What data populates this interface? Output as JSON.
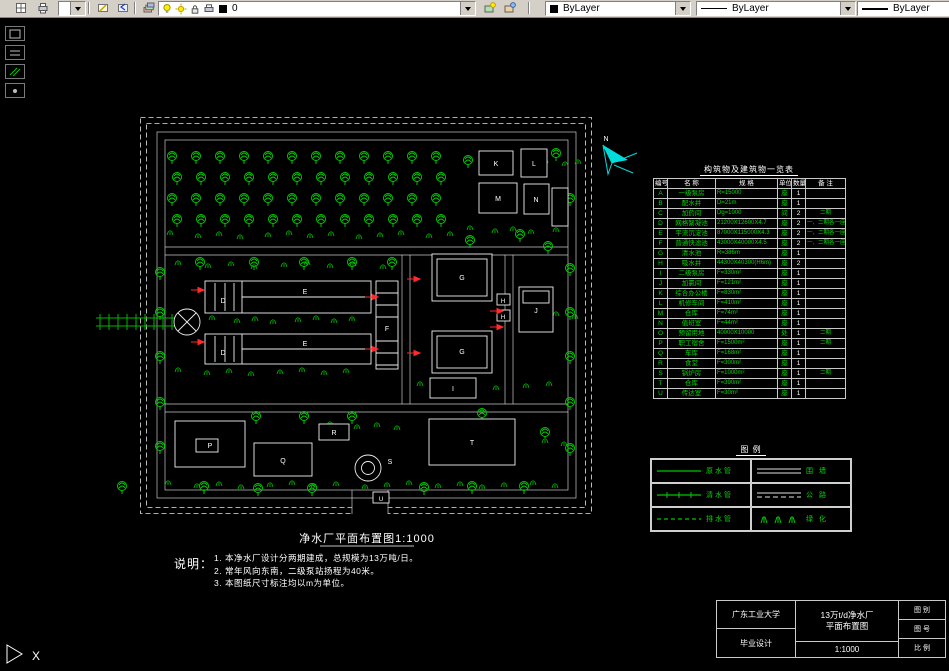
{
  "toolbar": {
    "layer_name": "0",
    "color_value": "ByLayer",
    "linetype_value": "ByLayer",
    "lineweight_value": "ByLayer"
  },
  "plan": {
    "title": "净水厂平面布置图1:1000",
    "north": "N",
    "letters": {
      "D": "D",
      "E": "E",
      "F": "F",
      "G": "G",
      "H": "H",
      "I": "I",
      "J": "J",
      "K": "K",
      "L": "L",
      "M": "M",
      "N": "N",
      "P": "P",
      "Q": "Q",
      "R": "R",
      "S": "S",
      "T": "T",
      "U": "U"
    }
  },
  "ucs": {
    "x_label": "X"
  },
  "notes": {
    "heading": "说明：",
    "items": [
      "1. 本净水厂设计分两期建成，总规模为13万吨/日。",
      "2. 常年风向东南，二级泵站扬程为40米。",
      "3. 本图纸尺寸标注均以m为单位。"
    ]
  },
  "struct_table": {
    "title": "构筑物及建筑物一览表",
    "headers": [
      "编号",
      "名 称",
      "规 格",
      "单位",
      "数量",
      "备 注"
    ],
    "rows": [
      {
        "code": "A",
        "name": "一级泵房",
        "spec": "R=15000",
        "unit": "座",
        "qty": "1",
        "remark": ""
      },
      {
        "code": "B",
        "name": "配水井",
        "spec": "D=21m",
        "unit": "座",
        "qty": "1",
        "remark": ""
      },
      {
        "code": "C",
        "name": "加药间",
        "spec": "Dg=1000",
        "unit": "间",
        "qty": "2",
        "remark": "二期"
      },
      {
        "code": "D",
        "name": "网格絮凝池",
        "spec": "21200X12600X4.7",
        "unit": "座",
        "qty": "2",
        "remark": "一、二期各一座"
      },
      {
        "code": "E",
        "name": "平流沉淀池",
        "spec": "87000X115000X4.3",
        "unit": "座",
        "qty": "2",
        "remark": "一、二期各一座"
      },
      {
        "code": "F",
        "name": "普通快滤池",
        "spec": "43000X40000X4.5",
        "unit": "座",
        "qty": "2",
        "remark": "一、二期各一座"
      },
      {
        "code": "G",
        "name": "清水池",
        "spec": "R=386m",
        "unit": "座",
        "qty": "1",
        "remark": ""
      },
      {
        "code": "H",
        "name": "吸水井",
        "spec": "44300X40300(H6m)",
        "unit": "座",
        "qty": "2",
        "remark": ""
      },
      {
        "code": "I",
        "name": "二级泵房",
        "spec": "F=330m²",
        "unit": "座",
        "qty": "1",
        "remark": ""
      },
      {
        "code": "J",
        "name": "加氯间",
        "spec": "F=121m²",
        "unit": "座",
        "qty": "1",
        "remark": ""
      },
      {
        "code": "K",
        "name": "综合办公楼",
        "spec": "F=830m²",
        "unit": "座",
        "qty": "1",
        "remark": ""
      },
      {
        "code": "L",
        "name": "机修车间",
        "spec": "F=410m²",
        "unit": "座",
        "qty": "1",
        "remark": ""
      },
      {
        "code": "M",
        "name": "仓库",
        "spec": "F=74m²",
        "unit": "座",
        "qty": "1",
        "remark": ""
      },
      {
        "code": "N",
        "name": "值班室",
        "spec": "F=44m²",
        "unit": "座",
        "qty": "1",
        "remark": ""
      },
      {
        "code": "O",
        "name": "预留用地",
        "spec": "40000X10000",
        "unit": "处",
        "qty": "1",
        "remark": "二期"
      },
      {
        "code": "P",
        "name": "职工宿舍",
        "spec": "F=1500m²",
        "unit": "座",
        "qty": "1",
        "remark": "二期"
      },
      {
        "code": "Q",
        "name": "车库",
        "spec": "F=168m²",
        "unit": "座",
        "qty": "1",
        "remark": ""
      },
      {
        "code": "R",
        "name": "食堂",
        "spec": "F=300m²",
        "unit": "座",
        "qty": "1",
        "remark": ""
      },
      {
        "code": "S",
        "name": "锅炉房",
        "spec": "F=1000m²",
        "unit": "座",
        "qty": "1",
        "remark": "二期"
      },
      {
        "code": "T",
        "name": "仓库",
        "spec": "F=390m²",
        "unit": "座",
        "qty": "1",
        "remark": ""
      },
      {
        "code": "U",
        "name": "传达室",
        "spec": "F=30m²",
        "unit": "座",
        "qty": "1",
        "remark": ""
      }
    ]
  },
  "legend": {
    "title": "图 例",
    "items": [
      {
        "label": "原水管"
      },
      {
        "label": "围 墙"
      },
      {
        "label": "清水管"
      },
      {
        "label": "公 路"
      },
      {
        "label": "排水管"
      },
      {
        "label": "绿 化"
      }
    ]
  },
  "titleblock": {
    "school": "广东工业大学",
    "subtitle": "毕业设计",
    "project_line1": "13万t/d净水厂",
    "project_line2": "平面布置图",
    "scale": "1:1000",
    "fields": [
      "图 别",
      "图 号",
      "比 例"
    ]
  }
}
